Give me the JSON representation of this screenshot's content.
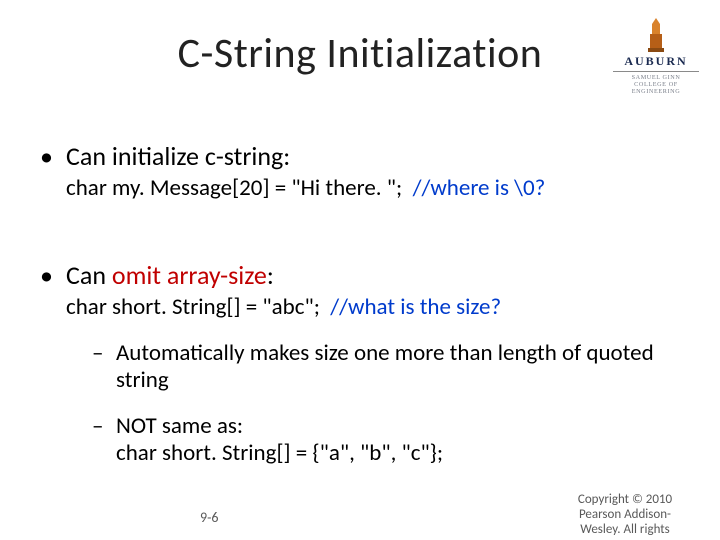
{
  "title": "C-String Initialization",
  "logo": {
    "name": "AUBURN",
    "sub1": "SAMUEL GINN",
    "sub2": "COLLEGE OF ENGINEERING"
  },
  "bullets": {
    "b1": {
      "head": "Can initialize c-string:",
      "code": "char my. Message[20] = \"Hi there. \";",
      "comment": "//where is \\0?"
    },
    "b2": {
      "head_pre": "Can ",
      "head_red": "omit array-size",
      "head_post": ":",
      "code": "char short. String[] = \"abc\";",
      "comment": "//what is the size?",
      "sub1": "Automatically makes size one more than length of quoted string",
      "sub2_a": "NOT same as:",
      "sub2_b": "char short. String[] = {\"a\", \"b\", \"c\"};"
    }
  },
  "footer": {
    "page": "9-6",
    "copy": "Copyright © 2010 Pearson Addison-Wesley. All rights"
  }
}
